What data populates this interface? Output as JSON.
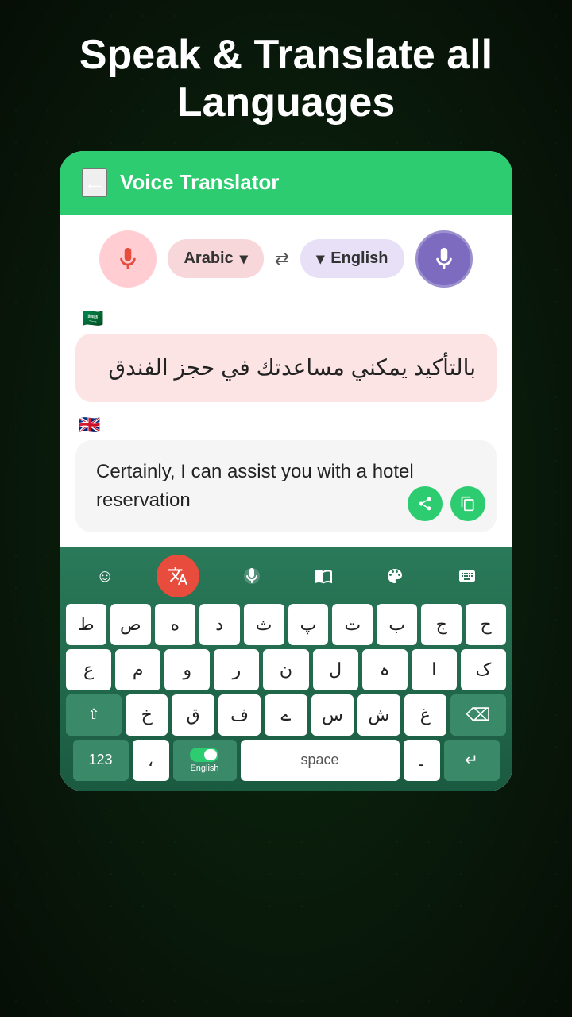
{
  "hero": {
    "title": "Speak & Translate all Languages"
  },
  "header": {
    "back_label": "←",
    "title": "Voice Translator"
  },
  "lang_row": {
    "source_lang": "Arabic",
    "source_lang_dropdown": "▾",
    "swap_icon": "⇄",
    "target_lang_dropdown": "▾",
    "target_lang": "English"
  },
  "chat": {
    "arabic_flag": "🇸🇦",
    "arabic_text": "بالتأكيد يمكني مساعدتك في حجز الفندق",
    "english_flag": "🇬🇧",
    "english_text": "Certainly, I can assist you with a hotel reservation",
    "share_icon": "share",
    "copy_icon": "copy"
  },
  "keyboard": {
    "toolbar": {
      "emoji_icon": "☺",
      "translate_active_icon": "🌐",
      "mic_icon": "🎤",
      "dict_icon": "📖",
      "palette_icon": "🎨",
      "keyboard_icon": "⌨"
    },
    "rows": {
      "row1": [
        "ط",
        "ص",
        "ه",
        "د",
        "ث",
        "پ",
        "ت",
        "ب",
        "ج",
        "ح"
      ],
      "row2": [
        "ع",
        "م",
        "و",
        "ر",
        "ن",
        "ل",
        "ہ",
        "ا",
        "ک"
      ],
      "row3_shift": "⇧",
      "row3": [
        "خ",
        "ق",
        "ف",
        "ے",
        "س",
        "ش",
        "غ"
      ],
      "row3_backspace": "⌫",
      "row4_nums": "123",
      "row4_comma": "،",
      "row4_lang": "English",
      "row4_space": "space",
      "row4_dot": "۔",
      "row4_enter": "↵"
    }
  }
}
